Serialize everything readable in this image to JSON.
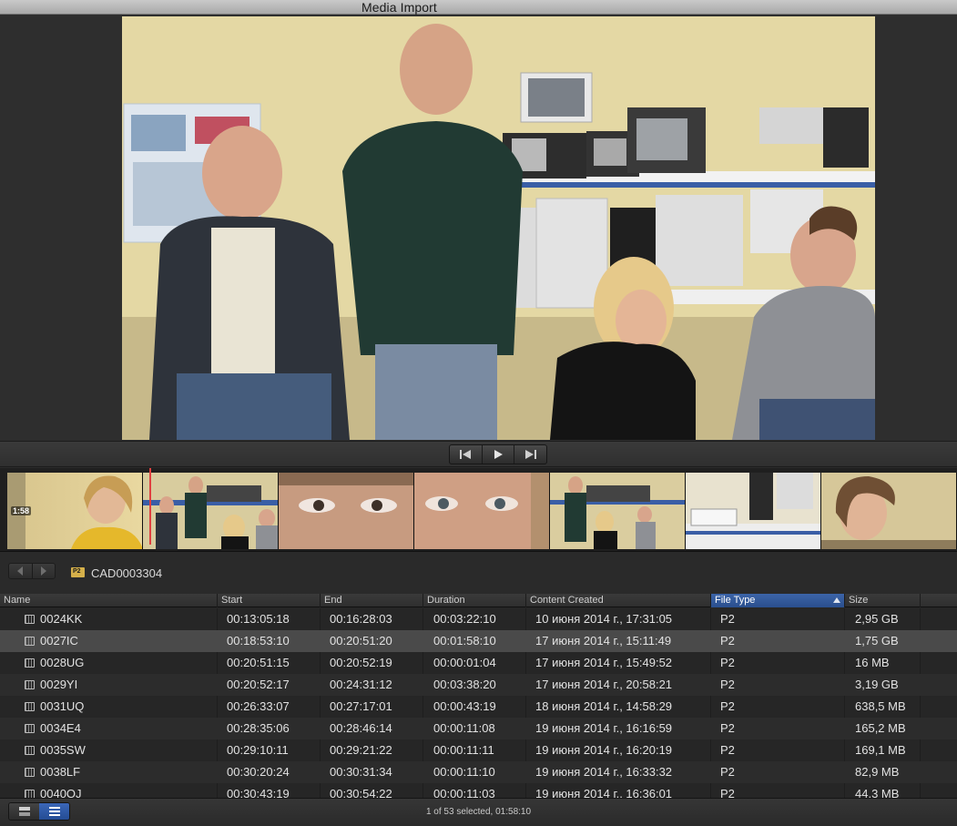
{
  "window": {
    "title": "Media Import"
  },
  "transport": {
    "prev_icon": "skip-to-start-icon",
    "play_icon": "play-icon",
    "next_icon": "skip-to-end-icon"
  },
  "filmstrip": {
    "frames": [
      {
        "badge": "1:58"
      },
      {
        "badge": ""
      },
      {
        "badge": ""
      },
      {
        "badge": ""
      },
      {
        "badge": ""
      },
      {
        "badge": ""
      },
      {
        "badge": ""
      }
    ]
  },
  "navigation": {
    "back_icon": "chevron-left-icon",
    "forward_icon": "chevron-right-icon",
    "folder_badge": "P2",
    "folder_name": "CAD0003304"
  },
  "table": {
    "columns": {
      "name": "Name",
      "start": "Start",
      "end": "End",
      "duration": "Duration",
      "created": "Content Created",
      "filetype": "File Type",
      "size": "Size"
    },
    "sorted_column": "File Type",
    "rows": [
      {
        "name": "0024KK",
        "start": "00:13:05:18",
        "end": "00:16:28:03",
        "duration": "00:03:22:10",
        "created": "10 июня 2014 г., 17:31:05",
        "filetype": "P2",
        "size": "2,95 GB"
      },
      {
        "name": "0027IC",
        "start": "00:18:53:10",
        "end": "00:20:51:20",
        "duration": "00:01:58:10",
        "created": "17 июня 2014 г., 15:11:49",
        "filetype": "P2",
        "size": "1,75 GB",
        "selected": true
      },
      {
        "name": "0028UG",
        "start": "00:20:51:15",
        "end": "00:20:52:19",
        "duration": "00:00:01:04",
        "created": "17 июня 2014 г., 15:49:52",
        "filetype": "P2",
        "size": "16 MB"
      },
      {
        "name": "0029YI",
        "start": "00:20:52:17",
        "end": "00:24:31:12",
        "duration": "00:03:38:20",
        "created": "17 июня 2014 г., 20:58:21",
        "filetype": "P2",
        "size": "3,19 GB"
      },
      {
        "name": "0031UQ",
        "start": "00:26:33:07",
        "end": "00:27:17:01",
        "duration": "00:00:43:19",
        "created": "18 июня 2014 г., 14:58:29",
        "filetype": "P2",
        "size": "638,5 MB"
      },
      {
        "name": "0034E4",
        "start": "00:28:35:06",
        "end": "00:28:46:14",
        "duration": "00:00:11:08",
        "created": "19 июня 2014 г., 16:16:59",
        "filetype": "P2",
        "size": "165,2 MB"
      },
      {
        "name": "0035SW",
        "start": "00:29:10:11",
        "end": "00:29:21:22",
        "duration": "00:00:11:11",
        "created": "19 июня 2014 г., 16:20:19",
        "filetype": "P2",
        "size": "169,1 MB"
      },
      {
        "name": "0038LF",
        "start": "00:30:20:24",
        "end": "00:30:31:34",
        "duration": "00:00:11:10",
        "created": "19 июня 2014 г., 16:33:32",
        "filetype": "P2",
        "size": "82,9 MB"
      },
      {
        "name": "0040OJ",
        "start": "00:30:43:19",
        "end": "00:30:54:22",
        "duration": "00:00:11:03",
        "created": "19 июня 2014 г., 16:36:01",
        "filetype": "P2",
        "size": "44,3 MB"
      }
    ]
  },
  "status": {
    "text": "1 of 53 selected, 01:58:10",
    "filmstrip_view_icon": "filmstrip-view-icon",
    "list_view_icon": "list-view-icon"
  }
}
